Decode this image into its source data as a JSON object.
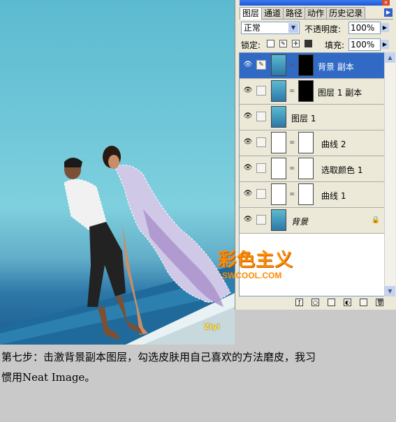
{
  "panel": {
    "tabs": [
      "图层",
      "通道",
      "路径",
      "动作",
      "历史记录"
    ],
    "active_tab": "图层",
    "blend_mode": "正常",
    "opacity_label": "不透明度:",
    "opacity_value": "100%",
    "lock_label": "锁定:",
    "fill_label": "填充:",
    "fill_value": "100%",
    "layers": [
      {
        "name": "背景 副本",
        "selected": true
      },
      {
        "name": "图层 1 副本",
        "selected": false
      },
      {
        "name": "图层 1",
        "selected": false
      },
      {
        "name": "曲线 2",
        "selected": false
      },
      {
        "name": "选取颜色 1",
        "selected": false
      },
      {
        "name": "曲线 1",
        "selected": false
      },
      {
        "name": "背景",
        "selected": false
      }
    ]
  },
  "logo": {
    "cn": "彩色主义",
    "en": "SWCOOL.COM"
  },
  "watermark": "Ziyi",
  "caption": {
    "line1": "第七步：击激背景副本图层，勾选皮肤用自己喜欢的方法磨皮，我习",
    "line2": "惯用Neat Image。"
  },
  "colors": {
    "selection": "#316ac5",
    "panel_bg": "#ece9d8",
    "logo": "#ff8a00"
  }
}
